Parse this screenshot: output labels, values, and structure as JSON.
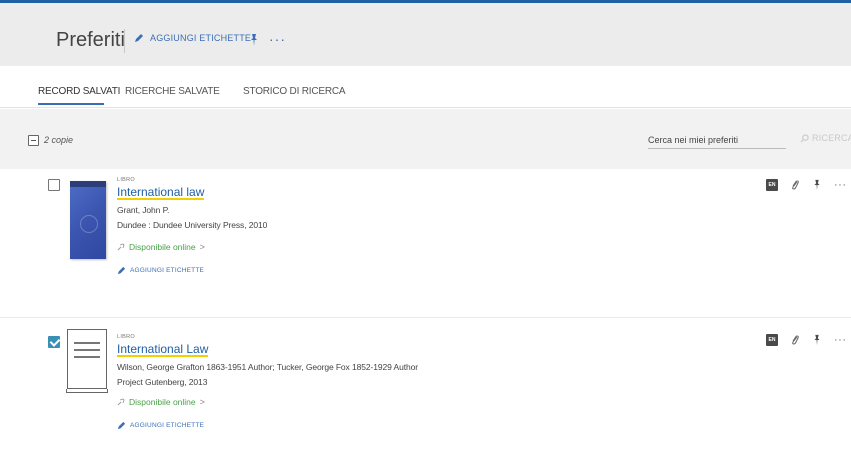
{
  "header": {
    "title": "Preferiti",
    "add_tags_label": "AGGIUNGI ETICHETTE",
    "more_label": "···"
  },
  "tabs": [
    {
      "label": "RECORD SALVATI",
      "active": true
    },
    {
      "label": "RICERCHE SALVATE",
      "active": false
    },
    {
      "label": "STORICO DI RICERCA",
      "active": false
    }
  ],
  "toolbar": {
    "count_label": "2 copie",
    "search_placeholder": "Cerca nei miei preferiti",
    "search_button_label": "RICERCA"
  },
  "records": [
    {
      "type": "LIBRO",
      "title": "International law",
      "authors": "Grant, John P.",
      "publication": "Dundee : Dundee University Press, 2010",
      "availability": "Disponibile online",
      "availability_chevron": ">",
      "add_tags_label": "AGGIUNGI ETICHETTE",
      "checked": false,
      "badge": "EN",
      "more_label": "···"
    },
    {
      "type": "LIBRO",
      "title": "International Law",
      "authors": "Wilson, George Grafton 1863-1951 Author; Tucker, George Fox 1852-1929 Author",
      "publication": "Project Gutenberg, 2013",
      "availability": "Disponibile online",
      "availability_chevron": ">",
      "add_tags_label": "AGGIUNGI ETICHETTE",
      "checked": true,
      "badge": "EN",
      "more_label": "···"
    }
  ],
  "colors": {
    "accent": "#1f5fa3",
    "link_blue": "#3b6fb5",
    "available_green": "#4aa04a",
    "title_underline": "#f0d000",
    "checkbox_checked": "#3a8fb5"
  }
}
